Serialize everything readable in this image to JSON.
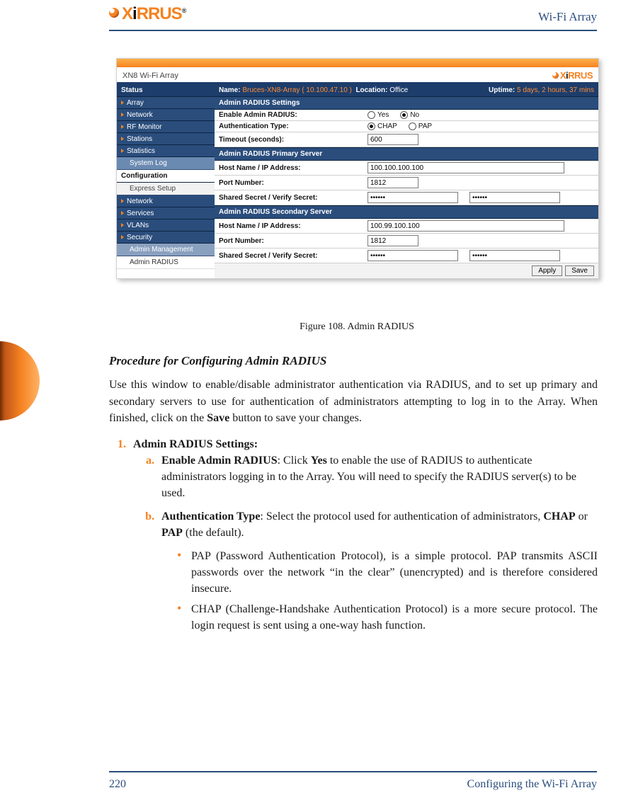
{
  "header": {
    "doc_title": "Wi-Fi Array",
    "brand": {
      "left": "X",
      "mid1": "i",
      "mid2": "RRUS",
      "reg": "®"
    }
  },
  "footer": {
    "page": "220",
    "chapter": "Configuring the Wi-Fi Array"
  },
  "shot": {
    "window_title": "XN8 Wi-Fi Array",
    "status": {
      "name_label": "Name:",
      "name": "Bruces-XN8-Array",
      "ip": "( 10.100.47.10 )",
      "loc_label": "Location:",
      "loc": "Office",
      "up_label": "Uptime:",
      "uptime": "5 days, 2 hours, 37 mins"
    },
    "nav": {
      "status_label": "Status",
      "items1": [
        "Array",
        "Network",
        "RF Monitor",
        "Stations",
        "Statistics"
      ],
      "syslog": "System Log",
      "config_label": "Configuration",
      "express": "Express Setup",
      "items2": [
        "Network",
        "Services",
        "VLANs",
        "Security"
      ],
      "admin_mgmt": "Admin Management",
      "admin_radius": "Admin RADIUS"
    },
    "groups": {
      "settings": "Admin RADIUS Settings",
      "primary": "Admin RADIUS Primary Server",
      "secondary": "Admin RADIUS Secondary Server"
    },
    "rows": {
      "enable_label": "Enable Admin RADIUS:",
      "yes": "Yes",
      "no": "No",
      "enable_selected": "no",
      "auth_label": "Authentication Type:",
      "chap": "CHAP",
      "pap": "PAP",
      "auth_selected": "chap",
      "timeout_label": "Timeout (seconds):",
      "timeout": "600",
      "host_label": "Host Name / IP Address:",
      "port_label": "Port Number:",
      "secret_label": "Shared Secret / Verify Secret:",
      "primary_host": "100.100.100.100",
      "primary_port": "1812",
      "primary_secret": "••••••",
      "primary_verify": "••••••",
      "secondary_host": "100.99.100.100",
      "secondary_port": "1812",
      "secondary_secret": "••••••",
      "secondary_verify": "••••••"
    },
    "buttons": {
      "apply": "Apply",
      "save": "Save"
    }
  },
  "figure": {
    "caption": "Figure 108. Admin RADIUS"
  },
  "text": {
    "h3": "Procedure for Configuring Admin RADIUS",
    "p1a": "Use this window to enable/disable administrator authentication via RADIUS, and to set up primary and secondary servers to use for authentication of administrators attempting to log in to the Array. When finished, click on the ",
    "p1b": "Save",
    "p1c": " button to save your changes.",
    "l1_head": "Admin RADIUS Settings:",
    "la_head": "Enable Admin RADIUS",
    "la_body": ": Click ",
    "la_bold": "Yes",
    "la_tail": " to enable the use of RADIUS to authenticate administrators logging in to the Array. You will need to specify the RADIUS server(s) to be used.",
    "lb_head": "Authentication Type",
    "lb_body1": ": Select the protocol used for authentication of administrators, ",
    "lb_chap": "CHAP",
    "lb_or": " or ",
    "lb_pap": "PAP",
    "lb_tail": " (the default).",
    "bullet_pap": "PAP (Password Authentication Protocol), is a simple protocol. PAP transmits ASCII passwords over the network “in the clear” (unencrypted) and is therefore considered insecure.",
    "bullet_chap": "CHAP (Challenge-Handshake Authentication Protocol) is a more secure protocol. The login request is sent using a one-way hash function."
  }
}
